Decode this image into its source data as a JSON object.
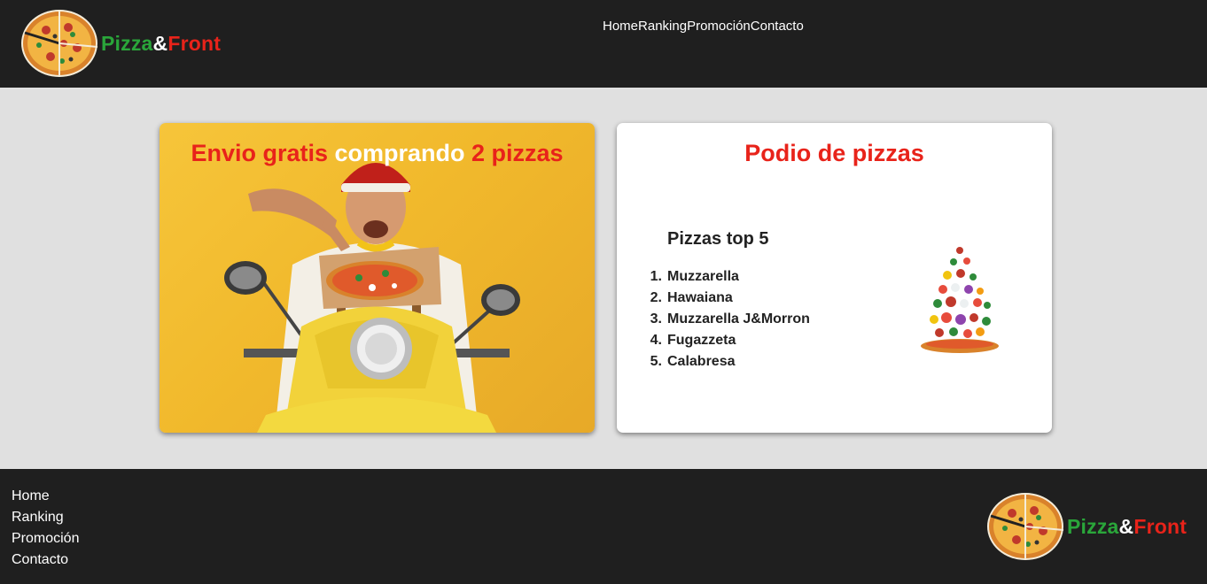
{
  "brand": {
    "name_part1": "Pizza",
    "name_amp": "&",
    "name_part2": "Front"
  },
  "nav": {
    "items": [
      "Home",
      "Ranking",
      "Promoción",
      "Contacto"
    ]
  },
  "promo": {
    "title_part1": "Envio gratis ",
    "title_part2": "comprando ",
    "title_part3": "2 pizzas"
  },
  "podio": {
    "title": "Podio de pizzas",
    "subtitle": "Pizzas top 5",
    "list": [
      {
        "num": "1.",
        "name": "Muzzarella"
      },
      {
        "num": "2.",
        "name": "Hawaiana"
      },
      {
        "num": "3.",
        "name": "Muzzarella J&Morron"
      },
      {
        "num": "4.",
        "name": "Fugazzeta"
      },
      {
        "num": "5.",
        "name": "Calabresa"
      }
    ]
  },
  "footer": {
    "items": [
      "Home",
      "Ranking",
      "Promoción",
      "Contacto"
    ]
  },
  "colors": {
    "header_bg": "#1f1f1f",
    "page_bg": "#e0e0e0",
    "brand_green": "#2aa63a",
    "brand_red": "#e8231a",
    "promo_yellow": "#f1b92c"
  },
  "icons": [
    "pizza-logo-icon",
    "delivery-scooter-image",
    "flying-pizza-image"
  ]
}
